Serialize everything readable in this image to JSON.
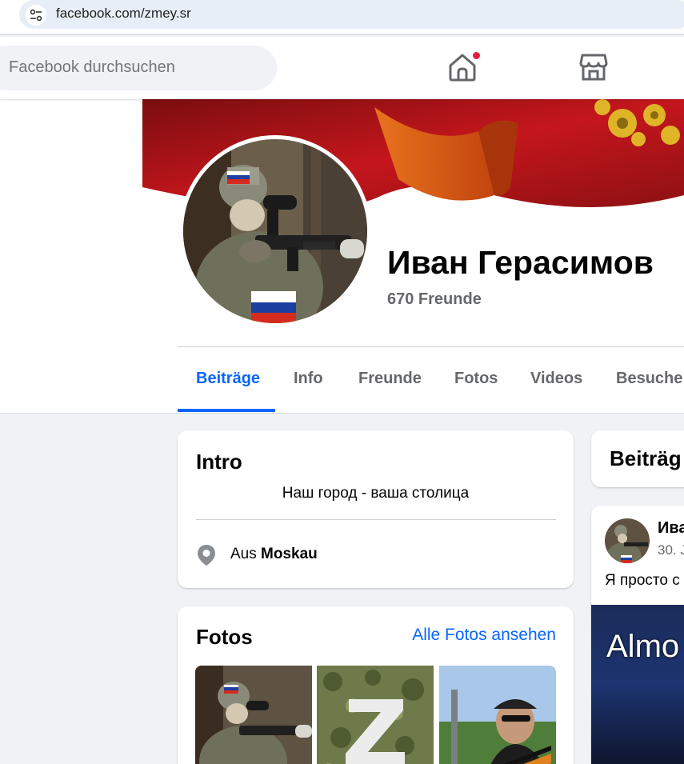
{
  "browser": {
    "url": "facebook.com/zmey.sr"
  },
  "nav": {
    "search_placeholder": "Facebook durchsuchen",
    "home_icon": "home-icon",
    "marketplace_icon": "marketplace-icon",
    "notification_color": "#e41e3f"
  },
  "profile": {
    "name": "Иван Герасимов",
    "friends": "670 Freunde"
  },
  "tabs": [
    {
      "label": "Beiträge",
      "active": true
    },
    {
      "label": "Info"
    },
    {
      "label": "Freunde"
    },
    {
      "label": "Fotos"
    },
    {
      "label": "Videos"
    },
    {
      "label": "Besuche"
    }
  ],
  "intro": {
    "title": "Intro",
    "bio": "Наш город - ваша столица",
    "location_prefix": "Aus",
    "location": "Moskau"
  },
  "photos": {
    "title": "Fotos",
    "see_all": "Alle Fotos ansehen"
  },
  "posts": {
    "title": "Beiträg",
    "post": {
      "author": "Ива",
      "date": "30. J",
      "text": "Я просто с",
      "media_text": "Almo"
    }
  },
  "colors": {
    "accent": "#0866ff",
    "secondary_text": "#65676b",
    "background": "#f0f2f5"
  }
}
